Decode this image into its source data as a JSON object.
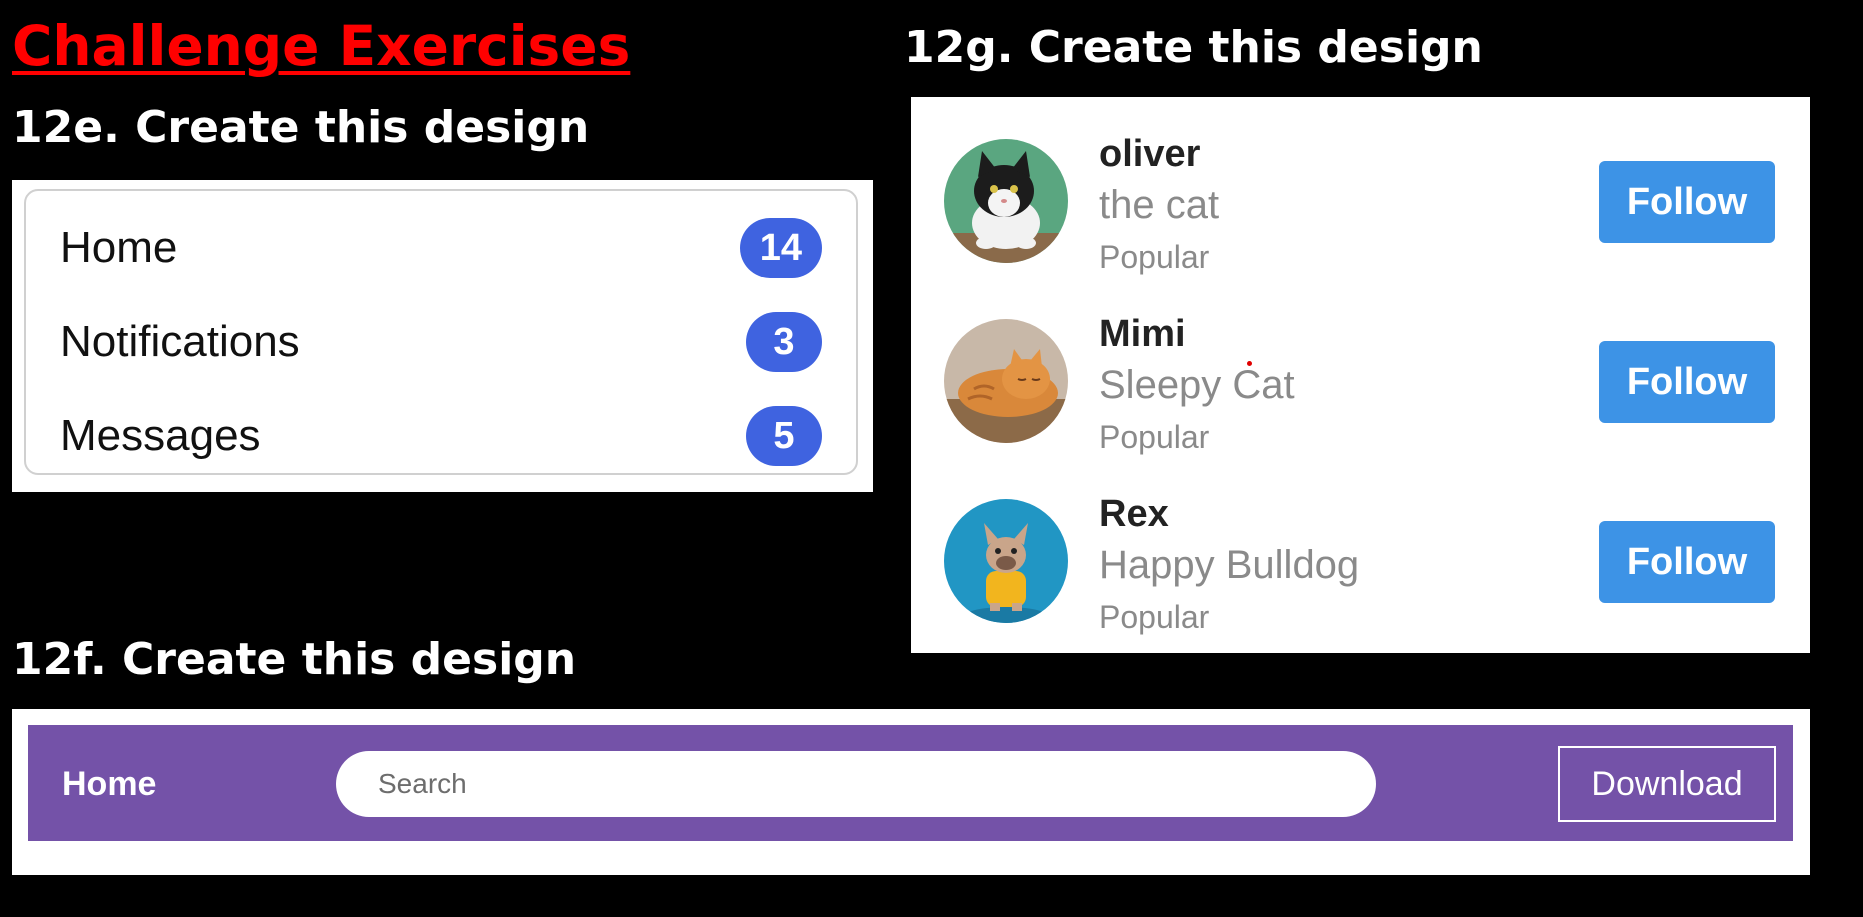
{
  "page": {
    "title": "Challenge Exercises",
    "exercise_e_heading": "12e. Create this design",
    "exercise_f_heading": "12f. Create this design",
    "exercise_g_heading": "12g. Create this design"
  },
  "sidebar": {
    "items": [
      {
        "label": "Home",
        "count": "14"
      },
      {
        "label": "Notifications",
        "count": "3"
      },
      {
        "label": "Messages",
        "count": "5"
      }
    ]
  },
  "profiles": {
    "items": [
      {
        "name": "oliver",
        "description": "the cat",
        "tag": "Popular",
        "button": "Follow",
        "avatar_icon": "tuxedo-cat-photo"
      },
      {
        "name": "Mimi",
        "description": "Sleepy Cat",
        "tag": "Popular",
        "button": "Follow",
        "avatar_icon": "orange-cat-photo"
      },
      {
        "name": "Rex",
        "description": "Happy Bulldog",
        "tag": "Popular",
        "button": "Follow",
        "avatar_icon": "bulldog-photo"
      }
    ]
  },
  "navbar": {
    "home_label": "Home",
    "search_placeholder": "Search",
    "download_label": "Download"
  },
  "colors": {
    "title_red": "#ff0000",
    "badge_blue": "#3f63e0",
    "follow_blue": "#3d93e6",
    "navbar_purple": "#7452a8"
  }
}
